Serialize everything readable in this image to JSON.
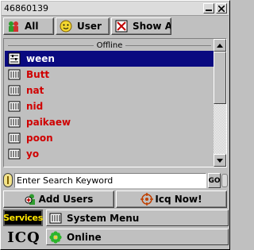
{
  "window": {
    "title": "46860139",
    "minimize_label": "▬",
    "close_label": "✕"
  },
  "toolbar": {
    "all_label": "All",
    "user_label": "User",
    "show_label": "Show AL"
  },
  "contacts": {
    "group_header": "Offline",
    "items": [
      {
        "name": "ween",
        "selected": true
      },
      {
        "name": "Butt",
        "selected": false
      },
      {
        "name": "nat",
        "selected": false
      },
      {
        "name": "nid",
        "selected": false
      },
      {
        "name": "paikaew",
        "selected": false
      },
      {
        "name": "poon",
        "selected": false
      },
      {
        "name": "yo",
        "selected": false
      }
    ]
  },
  "search": {
    "value": "Enter Search Keyword",
    "go_label": "GO"
  },
  "actions": {
    "add_users_label": "Add Users",
    "icq_now_label": "Icq Now!"
  },
  "services": {
    "button_label": "Services",
    "system_menu_label": "System Menu"
  },
  "status": {
    "logo_text": "ICQ",
    "label": "Online"
  },
  "colors": {
    "offline_contact": "#d00000",
    "selection_bg": "#0a0a80",
    "services_text": "#ffe600",
    "online_flower": "#2bb52b"
  }
}
